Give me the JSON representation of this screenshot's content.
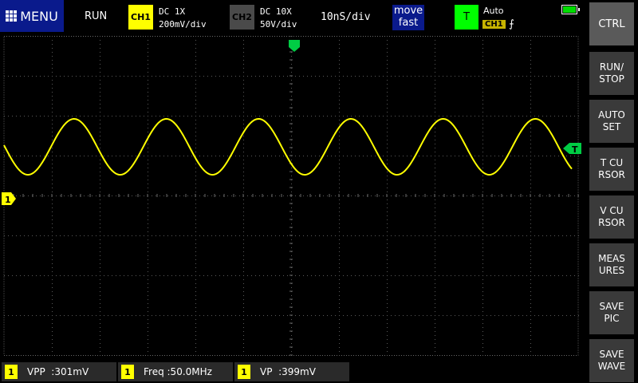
{
  "header": {
    "menu_label": "MENU",
    "run_status": "RUN",
    "ch1": {
      "tag": "CH1",
      "coupling": "DC  1X",
      "scale": "200mV/div",
      "color": "#ffff00"
    },
    "ch2": {
      "tag": "CH2",
      "coupling": "DC  10X",
      "scale": "50V/div",
      "color": "#4a4a4a"
    },
    "timebase": "10nS/div",
    "move": {
      "line1": "move",
      "line2": "fast"
    },
    "trigger": {
      "tag": "T",
      "mode": "Auto",
      "source": "CH1",
      "edge": "⨍",
      "color": "#00ff00"
    },
    "battery_level": 1.0
  },
  "scope": {
    "waveform": {
      "type": "sine",
      "channel": "CH1",
      "cycles_visible": 6,
      "color": "#ffff00"
    },
    "ch1_marker": "1",
    "trigger_marker": "T"
  },
  "side_buttons": [
    {
      "id": "ctrl",
      "label": "CTRL"
    },
    {
      "id": "run-stop",
      "label": "RUN/\nSTOP"
    },
    {
      "id": "auto-set",
      "label": "AUTO\nSET"
    },
    {
      "id": "t-cursor",
      "label": "T CU\nRSOR"
    },
    {
      "id": "v-cursor",
      "label": "V CU\nRSOR"
    },
    {
      "id": "measures",
      "label": "MEAS\nURES"
    },
    {
      "id": "save-pic",
      "label": "SAVE\nPIC"
    },
    {
      "id": "save-wave",
      "label": "SAVE\nWAVE"
    }
  ],
  "measurements": [
    {
      "channel": "1",
      "text": "VPP  :301mV"
    },
    {
      "channel": "1",
      "text": "Freq :50.0MHz"
    },
    {
      "channel": "1",
      "text": "VP  :399mV"
    }
  ]
}
